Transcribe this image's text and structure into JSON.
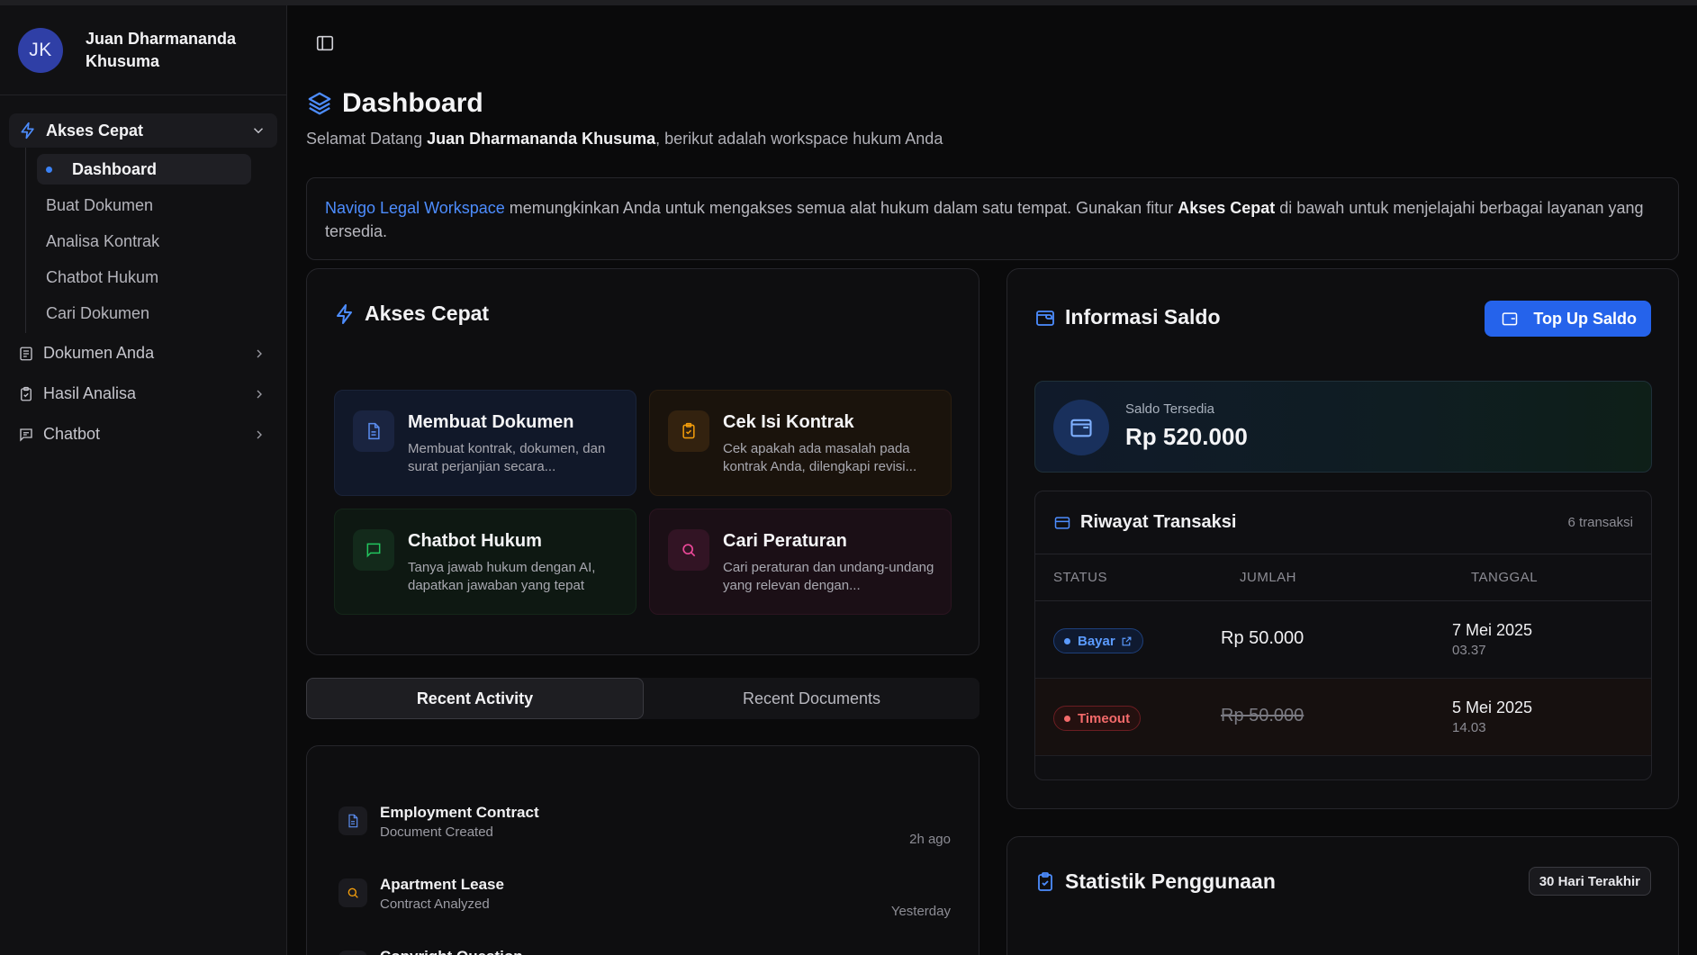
{
  "user": {
    "initials": "JK",
    "name": "Juan Dharmananda Khusuma"
  },
  "sidebar": {
    "group": {
      "label": "Akses Cepat",
      "items": [
        {
          "label": "Dashboard",
          "active": true
        },
        {
          "label": "Buat Dokumen"
        },
        {
          "label": "Analisa Kontrak"
        },
        {
          "label": "Chatbot Hukum"
        },
        {
          "label": "Cari Dokumen"
        }
      ]
    },
    "items": [
      {
        "label": "Dokumen Anda",
        "icon": "document-list-icon"
      },
      {
        "label": "Hasil Analisa",
        "icon": "clipboard-icon"
      },
      {
        "label": "Chatbot",
        "icon": "message-icon"
      }
    ]
  },
  "page": {
    "title": "Dashboard",
    "welcome_prefix": "Selamat Datang ",
    "welcome_name": "Juan Dharmananda Khusuma",
    "welcome_suffix": ", berikut adalah workspace hukum Anda"
  },
  "banner": {
    "link": "Navigo Legal Workspace",
    "text1": " memungkinkan Anda untuk mengakses semua alat hukum dalam satu tempat. Gunakan fitur ",
    "bold": "Akses Cepat",
    "text2": " di bawah untuk menjelajahi berbagai layanan yang tersedia."
  },
  "quick_access": {
    "title": "Akses Cepat",
    "tiles": [
      {
        "title": "Membuat Dokumen",
        "desc": "Membuat kontrak, dokumen, dan surat perjanjian secara...",
        "icon": "document-icon",
        "color": "#5b8def"
      },
      {
        "title": "Cek Isi Kontrak",
        "desc": "Cek apakah ada masalah pada kontrak Anda, dilengkapi revisi...",
        "icon": "clipboard-check-icon",
        "color": "#f59e0b"
      },
      {
        "title": "Chatbot Hukum",
        "desc": "Tanya jawab hukum dengan AI, dapatkan jawaban yang tepat",
        "icon": "message-icon",
        "color": "#22c55e"
      },
      {
        "title": "Cari Peraturan",
        "desc": "Cari peraturan dan undang-undang yang relevan dengan...",
        "icon": "search-icon",
        "color": "#ec4899"
      }
    ]
  },
  "tabs": [
    {
      "label": "Recent Activity",
      "active": true
    },
    {
      "label": "Recent Documents"
    }
  ],
  "activity": [
    {
      "title": "Employment Contract",
      "subtitle": "Document Created",
      "when": "2h ago",
      "icon": "document-icon"
    },
    {
      "title": "Apartment Lease",
      "subtitle": "Contract Analyzed",
      "when": "Yesterday",
      "icon": "search-icon"
    },
    {
      "title": "Copyright Question",
      "subtitle": "",
      "when": "",
      "icon": "message-icon"
    }
  ],
  "saldo": {
    "title": "Informasi Saldo",
    "topup_label": "Top Up Saldo",
    "balance_label": "Saldo Tersedia",
    "balance_value": "Rp 520.000"
  },
  "transactions": {
    "title": "Riwayat Transaksi",
    "count": "6 transaksi",
    "columns": [
      "STATUS",
      "JUMLAH",
      "TANGGAL"
    ],
    "rows": [
      {
        "status": "Bayar",
        "amount": "Rp 50.000",
        "date": "7 Mei 2025",
        "time": "03.37"
      },
      {
        "status": "Timeout",
        "amount": "Rp 50.000",
        "date": "5 Mei 2025",
        "time": "14.03"
      }
    ]
  },
  "stats": {
    "title": "Statistik Penggunaan",
    "period": "30 Hari Terakhir"
  },
  "colors": {
    "accent": "#2563eb",
    "link": "#4d8dff",
    "danger": "#f36a6a"
  }
}
